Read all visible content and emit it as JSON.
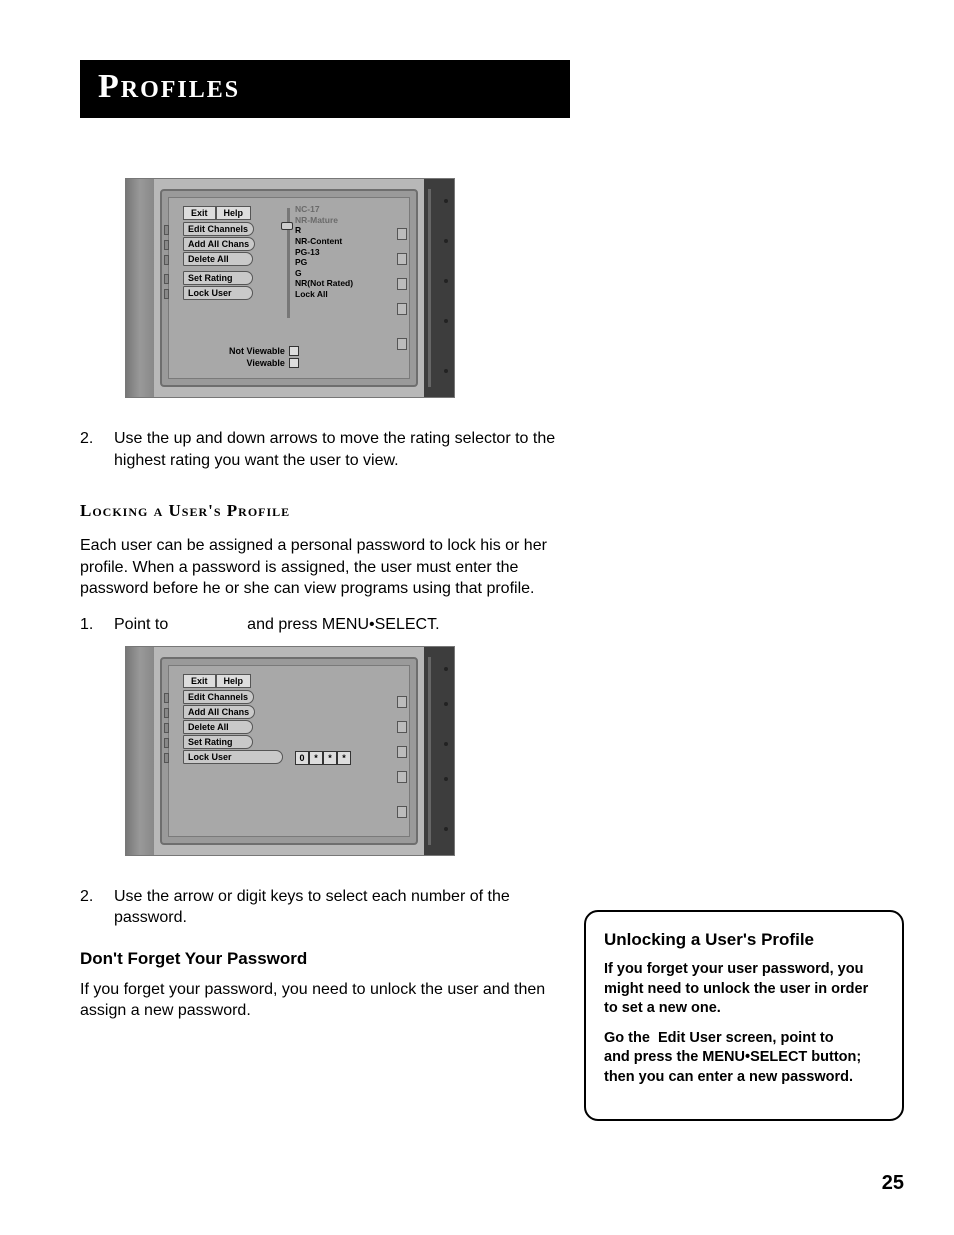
{
  "header": {
    "title": "Profiles"
  },
  "page_number": "25",
  "shot1": {
    "buttons": {
      "exit": "Exit",
      "help": "Help"
    },
    "menu": [
      "Edit Channels",
      "Add All Chans",
      "Delete All",
      "Set Rating",
      "Lock User"
    ],
    "ratings": [
      "NC-17",
      "NR-Mature",
      "R",
      "NR-Content",
      "PG-13",
      "PG",
      "G",
      "NR(Not Rated)",
      "Lock All"
    ],
    "legend": {
      "not_viewable": "Not Viewable",
      "viewable": "Viewable"
    }
  },
  "step_a2": "Use the up and down arrows to move the rating selector to the highest rating you want the user to view.",
  "section_locking": {
    "heading": "Locking a User's Profile",
    "intro": "Each user can be assigned a personal password to lock his or her profile. When a password is assigned, the user must enter the password before he or she can view programs using that profile.",
    "step1_a": "Point to",
    "step1_b": "and press MENU•SELECT."
  },
  "shot2": {
    "buttons": {
      "exit": "Exit",
      "help": "Help"
    },
    "menu": [
      "Edit Channels",
      "Add All Chans",
      "Delete All",
      "Set Rating",
      "Lock User"
    ],
    "pw": [
      "0",
      "*",
      "*",
      "*"
    ]
  },
  "step_b2": "Use the arrow or digit keys to select each number of the password.",
  "dont_forget": {
    "heading": "Don't Forget Your Password",
    "body": "If you forget your password, you need to unlock the user and then assign a new password."
  },
  "callout": {
    "heading": "Unlocking a User's Profile",
    "p1": "If you forget your user password, you might need to unlock the user in order to set a new one.",
    "p2": "Go the  Edit User screen, point to                and press the MENU•SELECT button; then you can enter a new password."
  }
}
